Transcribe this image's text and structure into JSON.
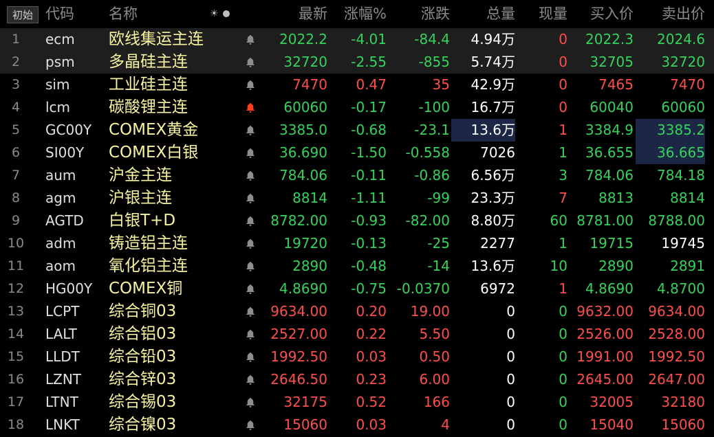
{
  "header": {
    "init_button": "初始",
    "code": "代码",
    "name": "名称",
    "sun_icon": "☀",
    "last": "最新",
    "pct": "涨幅%",
    "chg": "涨跌",
    "vol": "总量",
    "cur": "现量",
    "bid": "买入价",
    "ask": "卖出价"
  },
  "colors": {
    "up": "#ff4d4d",
    "down": "#33d35c",
    "name": "#f7f4a0",
    "alert_active": "#ff3b1f",
    "alert_idle": "#8e8e8e"
  },
  "rows": [
    {
      "num": "1",
      "code": "ecm",
      "name": "欧线集运主连",
      "last": "2022.2",
      "pct": "-4.01",
      "chg": "-84.4",
      "vol": "4.94万",
      "cur": "0",
      "bid": "2022.3",
      "ask": "2024.6",
      "dir": "down",
      "cur_dir": "red",
      "ask_color": "green"
    },
    {
      "num": "2",
      "code": "psm",
      "name": "多晶硅主连",
      "last": "32720",
      "pct": "-2.55",
      "chg": "-855",
      "vol": "5.74万",
      "cur": "0",
      "bid": "32705",
      "ask": "32720",
      "dir": "down",
      "cur_dir": "red",
      "ask_color": "green"
    },
    {
      "num": "3",
      "code": "sim",
      "name": "工业硅主连",
      "last": "7470",
      "pct": "0.47",
      "chg": "35",
      "vol": "42.9万",
      "cur": "0",
      "bid": "7465",
      "ask": "7470",
      "dir": "up",
      "cur_dir": "red",
      "ask_color": "red"
    },
    {
      "num": "4",
      "code": "lcm",
      "name": "碳酸锂主连",
      "last": "60060",
      "pct": "-0.17",
      "chg": "-100",
      "vol": "16.7万",
      "cur": "0",
      "bid": "60040",
      "ask": "60060",
      "dir": "down",
      "cur_dir": "red",
      "ask_color": "green"
    },
    {
      "num": "5",
      "code": "GC00Y",
      "name": "COMEX黄金",
      "last": "3385.0",
      "pct": "-0.68",
      "chg": "-23.1",
      "vol": "13.6万",
      "cur": "1",
      "bid": "3384.9",
      "ask": "3385.2",
      "dir": "down",
      "cur_dir": "red",
      "ask_color": "green"
    },
    {
      "num": "6",
      "code": "SI00Y",
      "name": "COMEX白银",
      "last": "36.690",
      "pct": "-1.50",
      "chg": "-0.558",
      "vol": "7026",
      "cur": "1",
      "bid": "36.655",
      "ask": "36.665",
      "dir": "down",
      "cur_dir": "green",
      "ask_color": "green"
    },
    {
      "num": "7",
      "code": "aum",
      "name": "沪金主连",
      "last": "784.06",
      "pct": "-0.11",
      "chg": "-0.86",
      "vol": "6.56万",
      "cur": "3",
      "bid": "784.06",
      "ask": "784.18",
      "dir": "down",
      "cur_dir": "green",
      "ask_color": "green"
    },
    {
      "num": "8",
      "code": "agm",
      "name": "沪银主连",
      "last": "8814",
      "pct": "-1.11",
      "chg": "-99",
      "vol": "23.3万",
      "cur": "7",
      "bid": "8813",
      "ask": "8814",
      "dir": "down",
      "cur_dir": "red",
      "ask_color": "green"
    },
    {
      "num": "9",
      "code": "AGTD",
      "name": "白银T+D",
      "last": "8782.00",
      "pct": "-0.93",
      "chg": "-82.00",
      "vol": "8.80万",
      "cur": "60",
      "bid": "8781.00",
      "ask": "8788.00",
      "dir": "down",
      "cur_dir": "green",
      "ask_color": "green"
    },
    {
      "num": "10",
      "code": "adm",
      "name": "铸造铝主连",
      "last": "19720",
      "pct": "-0.13",
      "chg": "-25",
      "vol": "2277",
      "cur": "1",
      "bid": "19715",
      "ask": "19745",
      "dir": "down",
      "cur_dir": "green",
      "ask_color": "white"
    },
    {
      "num": "11",
      "code": "aom",
      "name": "氧化铝主连",
      "last": "2890",
      "pct": "-0.48",
      "chg": "-14",
      "vol": "13.6万",
      "cur": "10",
      "bid": "2890",
      "ask": "2891",
      "dir": "down",
      "cur_dir": "green",
      "ask_color": "green"
    },
    {
      "num": "12",
      "code": "HG00Y",
      "name": "COMEX铜",
      "last": "4.8690",
      "pct": "-0.75",
      "chg": "-0.0370",
      "vol": "6972",
      "cur": "1",
      "bid": "4.8690",
      "ask": "4.8700",
      "dir": "down",
      "cur_dir": "red",
      "ask_color": "green"
    },
    {
      "num": "13",
      "code": "LCPT",
      "name": "综合铜03",
      "last": "9634.00",
      "pct": "0.20",
      "chg": "19.00",
      "vol": "0",
      "cur": "0",
      "bid": "9632.00",
      "ask": "9634.00",
      "dir": "up",
      "cur_dir": "green",
      "ask_color": "red"
    },
    {
      "num": "14",
      "code": "LALT",
      "name": "综合铝03",
      "last": "2527.00",
      "pct": "0.22",
      "chg": "5.50",
      "vol": "0",
      "cur": "0",
      "bid": "2526.00",
      "ask": "2528.00",
      "dir": "up",
      "cur_dir": "green",
      "ask_color": "red"
    },
    {
      "num": "15",
      "code": "LLDT",
      "name": "综合铅03",
      "last": "1992.50",
      "pct": "0.03",
      "chg": "0.50",
      "vol": "0",
      "cur": "0",
      "bid": "1991.00",
      "ask": "1992.50",
      "dir": "up",
      "cur_dir": "green",
      "ask_color": "red"
    },
    {
      "num": "16",
      "code": "LZNT",
      "name": "综合锌03",
      "last": "2646.50",
      "pct": "0.23",
      "chg": "6.00",
      "vol": "0",
      "cur": "0",
      "bid": "2645.00",
      "ask": "2647.00",
      "dir": "up",
      "cur_dir": "green",
      "ask_color": "red"
    },
    {
      "num": "17",
      "code": "LTNT",
      "name": "综合锡03",
      "last": "32175",
      "pct": "0.52",
      "chg": "166",
      "vol": "0",
      "cur": "0",
      "bid": "32005",
      "ask": "32180",
      "dir": "up",
      "cur_dir": "green",
      "ask_color": "red"
    },
    {
      "num": "18",
      "code": "LNKT",
      "name": "综合镍03",
      "last": "15060",
      "pct": "0.03",
      "chg": "4",
      "vol": "0",
      "cur": "0",
      "bid": "15040",
      "ask": "15060",
      "dir": "up",
      "cur_dir": "green",
      "ask_color": "red"
    }
  ]
}
